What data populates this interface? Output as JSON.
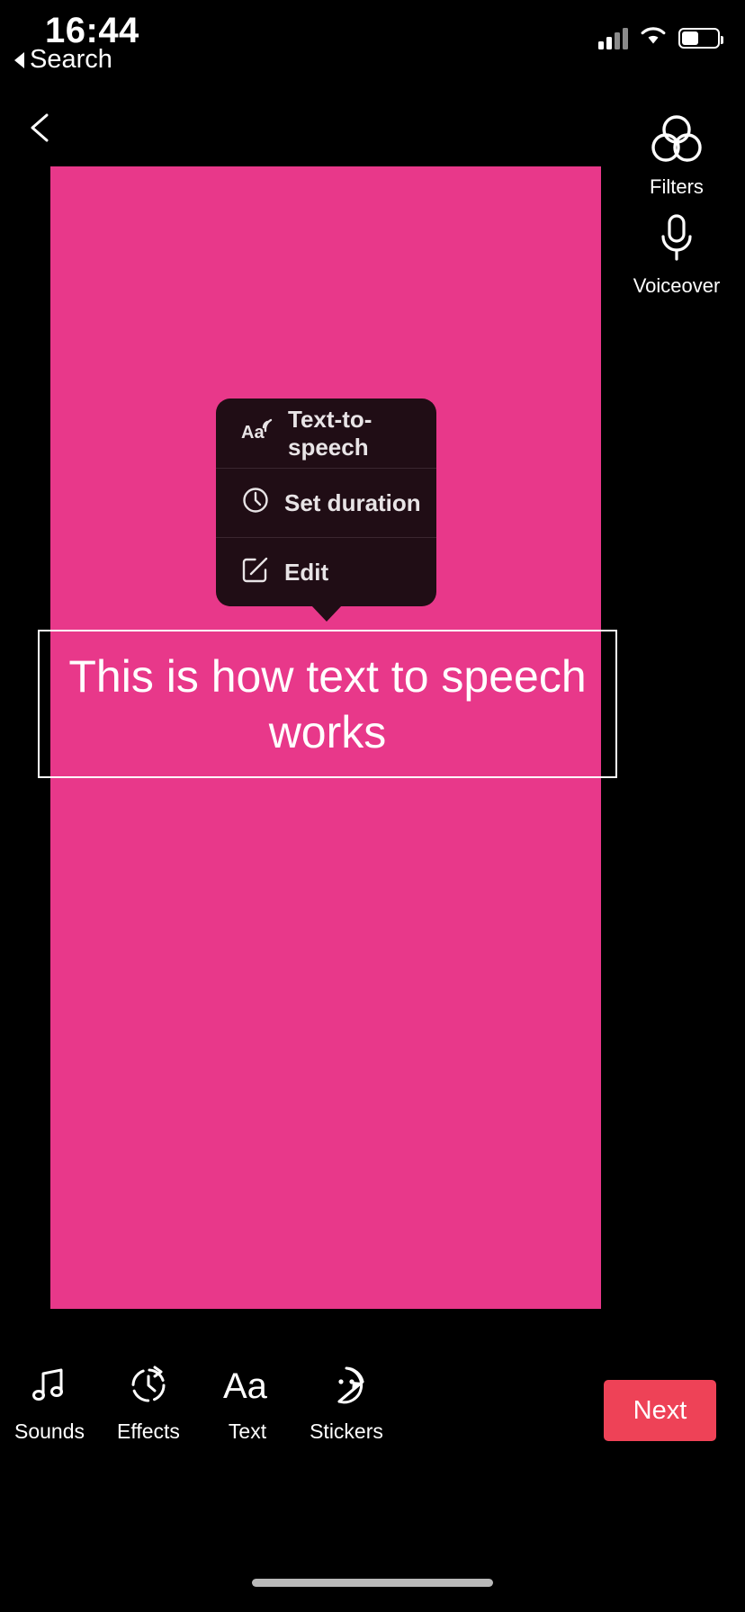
{
  "status_bar": {
    "time": "16:44",
    "back_label": "Search",
    "icons": [
      "cellular-signal-icon",
      "wifi-icon",
      "battery-icon"
    ]
  },
  "top_bar": {
    "back_icon": "chevron-left-icon",
    "tools": [
      {
        "id": "filters",
        "icon": "filters-circles-icon",
        "label": "Filters"
      },
      {
        "id": "voiceover",
        "icon": "microphone-icon",
        "label": "Voiceover"
      }
    ]
  },
  "canvas": {
    "background_color": "#E8388A"
  },
  "context_menu": {
    "background_color": "#200D15",
    "items": [
      {
        "id": "text-to-speech",
        "icon": "text-to-speech-icon",
        "label": "Text-to-speech"
      },
      {
        "id": "set-duration",
        "icon": "clock-icon",
        "label": "Set duration"
      },
      {
        "id": "edit",
        "icon": "pencil-square-icon",
        "label": "Edit"
      }
    ]
  },
  "text_overlay": {
    "value": "This is how text to speech works",
    "text_color": "#FFFFFF",
    "selected": true
  },
  "bottom_bar": {
    "tools": [
      {
        "id": "sounds",
        "icon": "music-note-icon",
        "label": "Sounds"
      },
      {
        "id": "effects",
        "icon": "effects-clock-icon",
        "label": "Effects"
      },
      {
        "id": "text",
        "icon": "text-aa-icon",
        "label": "Text"
      },
      {
        "id": "stickers",
        "icon": "sticker-smiley-icon",
        "label": "Stickers"
      }
    ],
    "next_button": {
      "label": "Next",
      "color": "#EE4257"
    }
  }
}
